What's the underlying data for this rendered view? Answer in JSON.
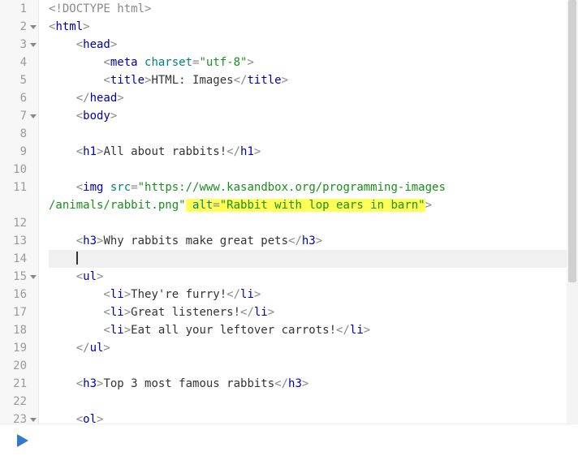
{
  "editor": {
    "active_line": 14,
    "gutter": [
      {
        "n": "1",
        "fold": false
      },
      {
        "n": "2",
        "fold": true
      },
      {
        "n": "3",
        "fold": true
      },
      {
        "n": "4",
        "fold": false
      },
      {
        "n": "5",
        "fold": false
      },
      {
        "n": "6",
        "fold": false
      },
      {
        "n": "7",
        "fold": true
      },
      {
        "n": "8",
        "fold": false
      },
      {
        "n": "9",
        "fold": false
      },
      {
        "n": "10",
        "fold": false
      },
      {
        "n": "11",
        "fold": false
      },
      {
        "n": "",
        "fold": false
      },
      {
        "n": "12",
        "fold": false
      },
      {
        "n": "13",
        "fold": false
      },
      {
        "n": "14",
        "fold": false
      },
      {
        "n": "15",
        "fold": true
      },
      {
        "n": "16",
        "fold": false
      },
      {
        "n": "17",
        "fold": false
      },
      {
        "n": "18",
        "fold": false
      },
      {
        "n": "19",
        "fold": false
      },
      {
        "n": "20",
        "fold": false
      },
      {
        "n": "21",
        "fold": false
      },
      {
        "n": "22",
        "fold": false
      },
      {
        "n": "23",
        "fold": true
      }
    ],
    "tokens": {
      "doctype": "<!DOCTYPE html>",
      "html_open_l": "<",
      "html_open_n": "html",
      "html_open_r": ">",
      "head_open_l": "<",
      "head_open_n": "head",
      "head_open_r": ">",
      "meta_l": "<",
      "meta_n": "meta",
      "meta_sp": " ",
      "meta_a": "charset",
      "meta_eq": "=",
      "meta_v": "\"utf-8\"",
      "meta_r": ">",
      "title_o_l": "<",
      "title_o_n": "title",
      "title_o_r": ">",
      "title_txt": "HTML: Images",
      "title_c_l": "</",
      "title_c_n": "title",
      "title_c_r": ">",
      "head_c_l": "</",
      "head_c_n": "head",
      "head_c_r": ">",
      "body_o_l": "<",
      "body_o_n": "body",
      "body_o_r": ">",
      "h1_o_l": "<",
      "h1_o_n": "h1",
      "h1_o_r": ">",
      "h1_txt": "All about rabbits!",
      "h1_c_l": "</",
      "h1_c_n": "h1",
      "h1_c_r": ">",
      "img_l": "<",
      "img_n": "img",
      "img_sp": " ",
      "img_a1": "src",
      "img_eq1": "=",
      "img_v1a": "\"https://www.kasandbox.org/programming-images",
      "img_v1b": "/animals/rabbit.png\"",
      "img_sp2": " ",
      "img_a2": "alt",
      "img_eq2": "=",
      "img_v2": "\"Rabbit with lop ears in barn\"",
      "img_r": ">",
      "h3a_o_l": "<",
      "h3a_o_n": "h3",
      "h3a_o_r": ">",
      "h3a_txt": "Why rabbits make great pets",
      "h3a_c_l": "</",
      "h3a_c_n": "h3",
      "h3a_c_r": ">",
      "ul_o_l": "<",
      "ul_o_n": "ul",
      "ul_o_r": ">",
      "li1_o_l": "<",
      "li1_o_n": "li",
      "li1_o_r": ">",
      "li1_txt": "They're furry!",
      "li1_c_l": "</",
      "li1_c_n": "li",
      "li1_c_r": ">",
      "li2_o_l": "<",
      "li2_o_n": "li",
      "li2_o_r": ">",
      "li2_txt": "Great listeners!",
      "li2_c_l": "</",
      "li2_c_n": "li",
      "li2_c_r": ">",
      "li3_o_l": "<",
      "li3_o_n": "li",
      "li3_o_r": ">",
      "li3_txt": "Eat all your leftover carrots!",
      "li3_c_l": "</",
      "li3_c_n": "li",
      "li3_c_r": ">",
      "ul_c_l": "</",
      "ul_c_n": "ul",
      "ul_c_r": ">",
      "h3b_o_l": "<",
      "h3b_o_n": "h3",
      "h3b_o_r": ">",
      "h3b_txt": "Top 3 most famous rabbits",
      "h3b_c_l": "</",
      "h3b_c_n": "h3",
      "h3b_c_r": ">",
      "ol_o_l": "<",
      "ol_o_n": "ol",
      "ol_o_r": ">"
    }
  }
}
